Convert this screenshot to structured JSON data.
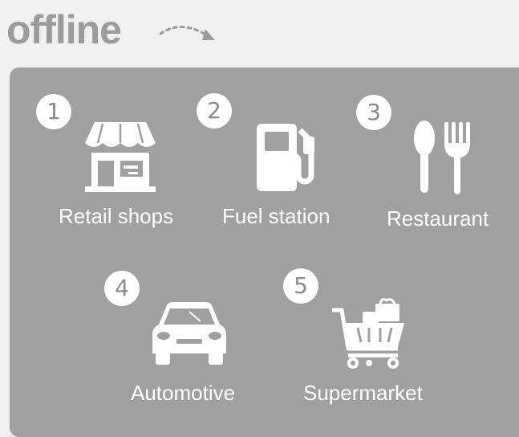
{
  "header": {
    "title": "offline"
  },
  "categories": [
    {
      "number": "1",
      "label": "Retail shops",
      "icon": "store-icon"
    },
    {
      "number": "2",
      "label": "Fuel station",
      "icon": "fuel-pump-icon"
    },
    {
      "number": "3",
      "label": "Restaurant",
      "icon": "spoon-fork-icon"
    },
    {
      "number": "4",
      "label": "Automotive",
      "icon": "car-icon"
    },
    {
      "number": "5",
      "label": "Supermarket",
      "icon": "shopping-cart-icon"
    }
  ],
  "colors": {
    "background": "#f0f0f0",
    "panel": "#a0a0a0",
    "title": "#9b9b9b",
    "badge": "#ffffff",
    "badge_text": "#8a8a8a",
    "icon": "#ffffff"
  }
}
